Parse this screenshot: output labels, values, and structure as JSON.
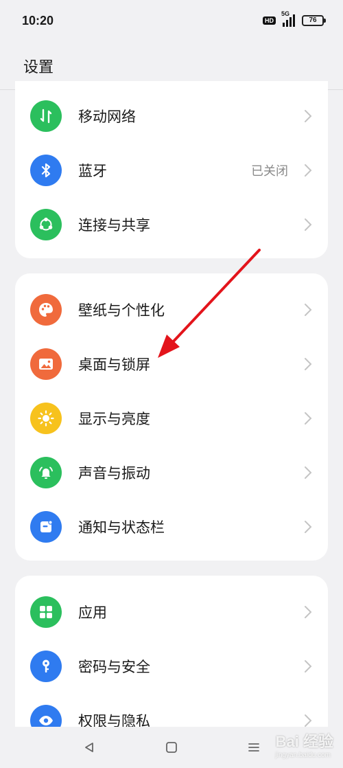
{
  "status_bar": {
    "time": "10:20",
    "hd": "HD",
    "network": "5G",
    "battery": "76"
  },
  "header": {
    "title": "设置"
  },
  "groups": [
    {
      "items": [
        {
          "label": "移动网络",
          "icon": "mobile-data-icon",
          "color": "#2bbf5d",
          "value": ""
        },
        {
          "label": "蓝牙",
          "icon": "bluetooth-icon",
          "color": "#2f7bf0",
          "value": "已关闭"
        },
        {
          "label": "连接与共享",
          "icon": "share-connect-icon",
          "color": "#2bbf5d",
          "value": ""
        }
      ]
    },
    {
      "items": [
        {
          "label": "壁纸与个性化",
          "icon": "palette-icon",
          "color": "#f06a3c",
          "value": ""
        },
        {
          "label": "桌面与锁屏",
          "icon": "wallpaper-image-icon",
          "color": "#f06a3c",
          "value": ""
        },
        {
          "label": "显示与亮度",
          "icon": "brightness-icon",
          "color": "#f7c21d",
          "value": ""
        },
        {
          "label": "声音与振动",
          "icon": "bell-icon",
          "color": "#2bbf5d",
          "value": ""
        },
        {
          "label": "通知与状态栏",
          "icon": "notification-icon",
          "color": "#2f7bf0",
          "value": ""
        }
      ]
    },
    {
      "items": [
        {
          "label": "应用",
          "icon": "apps-grid-icon",
          "color": "#2bbf5d",
          "value": ""
        },
        {
          "label": "密码与安全",
          "icon": "key-icon",
          "color": "#2f7bf0",
          "value": ""
        },
        {
          "label": "权限与隐私",
          "icon": "privacy-icon",
          "color": "#2f7bf0",
          "value": ""
        }
      ]
    }
  ],
  "annotation": {
    "color": "#e3141b"
  },
  "watermark": {
    "text": "Bai 经验",
    "url": "jingyan.baidu.com"
  }
}
